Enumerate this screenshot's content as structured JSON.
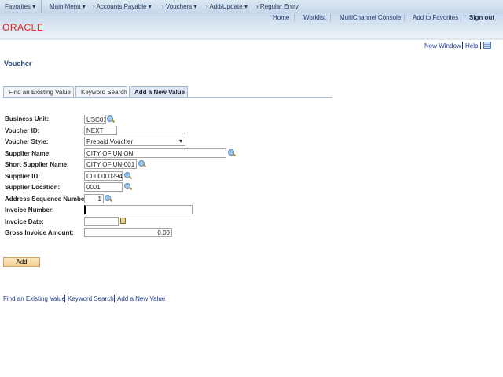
{
  "nav": {
    "favorites": "Favorites",
    "main_menu": "Main Menu",
    "crumbs": [
      "Accounts Payable",
      "Vouchers",
      "Add/Update",
      "Regular Entry"
    ]
  },
  "header": {
    "links": [
      "Home",
      "Worklist",
      "MultiChannel Console",
      "Add to Favorites"
    ],
    "sign_out": "Sign out",
    "logo": "ORACLE"
  },
  "toolbar": {
    "new_window": "New Window",
    "help": "Help"
  },
  "page_title": "Voucher",
  "tabs": [
    "Find an Existing Value",
    "Keyword Search",
    "Add a New Value"
  ],
  "active_tab": "Add a New Value",
  "form": {
    "business_unit": {
      "label": "Business Unit:",
      "value": "USC01"
    },
    "voucher_id": {
      "label": "Voucher ID:",
      "value": "NEXT"
    },
    "voucher_style": {
      "label": "Voucher Style:",
      "value": "Prepaid Voucher"
    },
    "supplier_name": {
      "label": "Supplier Name:",
      "value": "CITY OF UNION"
    },
    "short_supplier_name": {
      "label": "Short Supplier Name:",
      "value": "CITY OF UN-001"
    },
    "supplier_id": {
      "label": "Supplier ID:",
      "value": "C000000294"
    },
    "supplier_location": {
      "label": "Supplier Location:",
      "value": "0001"
    },
    "address_seq": {
      "label": "Address Sequence Number:",
      "value": "1"
    },
    "invoice_number": {
      "label": "Invoice Number:",
      "value": ""
    },
    "invoice_date": {
      "label": "Invoice Date:",
      "value": ""
    },
    "gross_amount": {
      "label": "Gross Invoice Amount:",
      "value": "0.00"
    }
  },
  "add_button": "Add",
  "bottom_links": [
    "Find an Existing Value",
    "Keyword Search",
    "Add a New Value"
  ]
}
